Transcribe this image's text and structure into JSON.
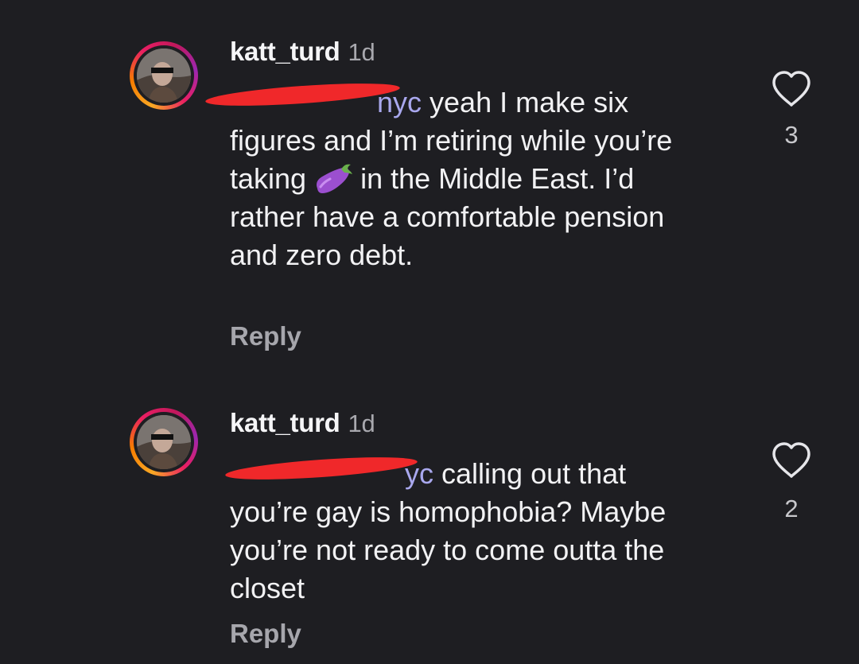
{
  "comments": [
    {
      "username": "katt_turd",
      "timestamp": "1d",
      "mention_visible": "nyc",
      "text_before_emoji": " yeah I make six figures and I’m retiring while you’re taking",
      "emoji": "eggplant",
      "text_after_emoji": "in the Middle East. I’d rather have a comfortable pension and zero debt.",
      "reply_label": "Reply",
      "like_count": "3"
    },
    {
      "username": "katt_turd",
      "timestamp": "1d",
      "mention_visible": "yc",
      "text": " calling out that you’re gay is homophobia? Maybe you’re not ready to come outta the closet",
      "reply_label": "Reply",
      "like_count": "2"
    }
  ],
  "colors": {
    "background": "#1e1e22",
    "mention": "#a9a8ee",
    "redaction": "#f0282a"
  }
}
